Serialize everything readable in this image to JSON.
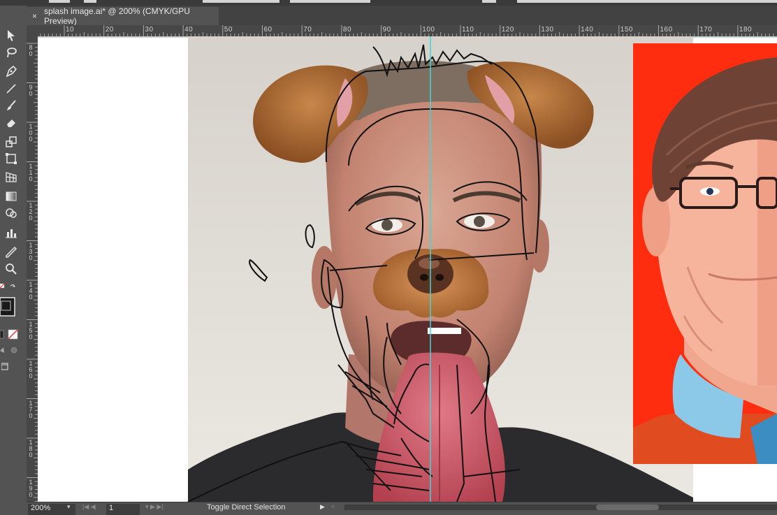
{
  "document": {
    "tab_title": "splash image.ai* @ 200% (CMYK/GPU Preview)",
    "close_glyph": "×"
  },
  "rulers": {
    "horizontal": [
      "10",
      "20",
      "30",
      "40",
      "50",
      "60",
      "70",
      "80",
      "90",
      "100",
      "110",
      "120",
      "130",
      "140",
      "150",
      "160",
      "170",
      "180"
    ],
    "vertical": [
      "80",
      "90",
      "100",
      "110",
      "120",
      "130",
      "140",
      "150",
      "160",
      "170",
      "180",
      "190"
    ]
  },
  "tools": [
    {
      "name": "selection-tool-icon"
    },
    {
      "name": "lasso-tool-icon"
    },
    {
      "name": "pen-tool-icon"
    },
    {
      "name": "line-tool-icon"
    },
    {
      "name": "paintbrush-tool-icon"
    },
    {
      "name": "eraser-tool-icon"
    },
    {
      "name": "scale-tool-icon"
    },
    {
      "name": "free-transform-tool-icon"
    },
    {
      "name": "perspective-grid-tool-icon"
    },
    {
      "name": "gradient-tool-icon"
    },
    {
      "name": "shape-builder-tool-icon"
    },
    {
      "name": "graph-tool-icon"
    },
    {
      "name": "eyedropper-tool-icon"
    },
    {
      "name": "zoom-tool-icon"
    },
    {
      "name": "fill-stroke-swatch-icon"
    },
    {
      "name": "color-mode-icon"
    },
    {
      "name": "draw-mode-icon"
    },
    {
      "name": "screen-mode-icon"
    }
  ],
  "status": {
    "zoom": "200%",
    "artboard": "1",
    "info": "Toggle Direct Selection"
  },
  "colors": {
    "guide": "#3fd6d6",
    "flat_bg": "#ff2d0f",
    "ui_dark": "#535353"
  }
}
